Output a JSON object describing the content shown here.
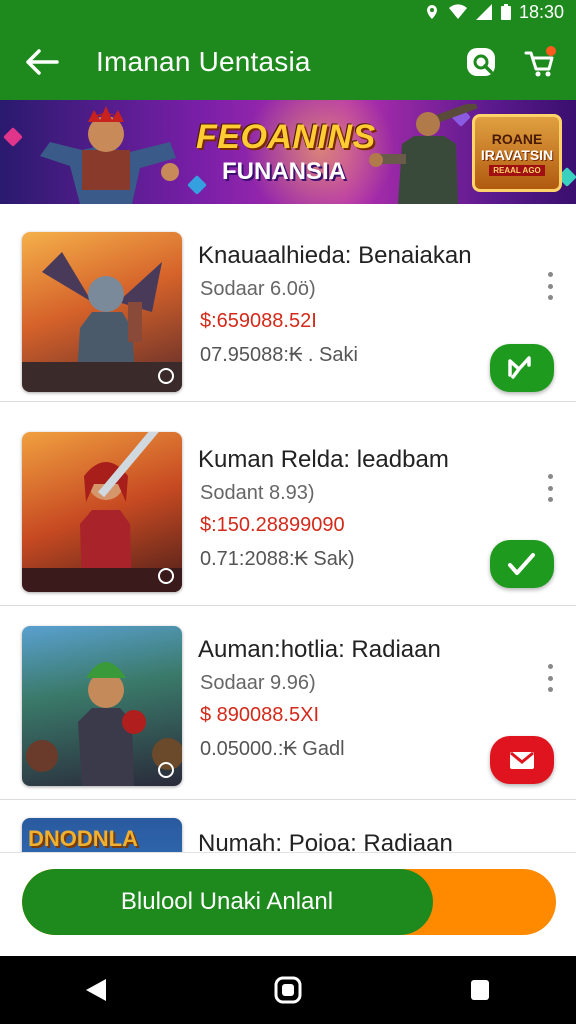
{
  "status_bar": {
    "time": "18:30"
  },
  "app_bar": {
    "title": "Imanan Uentasia"
  },
  "banner": {
    "brand_line1": "FEOANINS",
    "brand_line2": "FUNANSIA",
    "badge_line1": "ROANE",
    "badge_line2": "IRAVATSIN",
    "badge_line3": "REAAL AGO"
  },
  "items": [
    {
      "title": "Knauaalhieda: Benaiakan",
      "subtitle": "Sodaar 6.0ö)",
      "price": "$:659088.52I",
      "meta": "07.95088:₭ . Saki",
      "action": "green"
    },
    {
      "title": "Kuman Relda: leadbam",
      "subtitle": "Sodant 8.93)",
      "price": "$:150.28899090",
      "meta": "0.71:2088:₭  Sak)",
      "action": "green"
    },
    {
      "title": "Auman:hotlia: Radiaan",
      "subtitle": "Sodaar 9.96)",
      "price": "$ 890088.5XI",
      "meta": "0.05000.:₭  Gadl",
      "action": "red"
    },
    {
      "title": "Numah: Poioa: Radiaan",
      "thumb_text": "DNODNLA"
    }
  ],
  "cta": {
    "label": "Blulool Unaki Anlanl",
    "progress": 0.77
  },
  "colors": {
    "brand_green": "#1e8a1e",
    "accent_orange": "#ff8a00",
    "price_red": "#d32a1a",
    "fab_red": "#e0141e"
  }
}
